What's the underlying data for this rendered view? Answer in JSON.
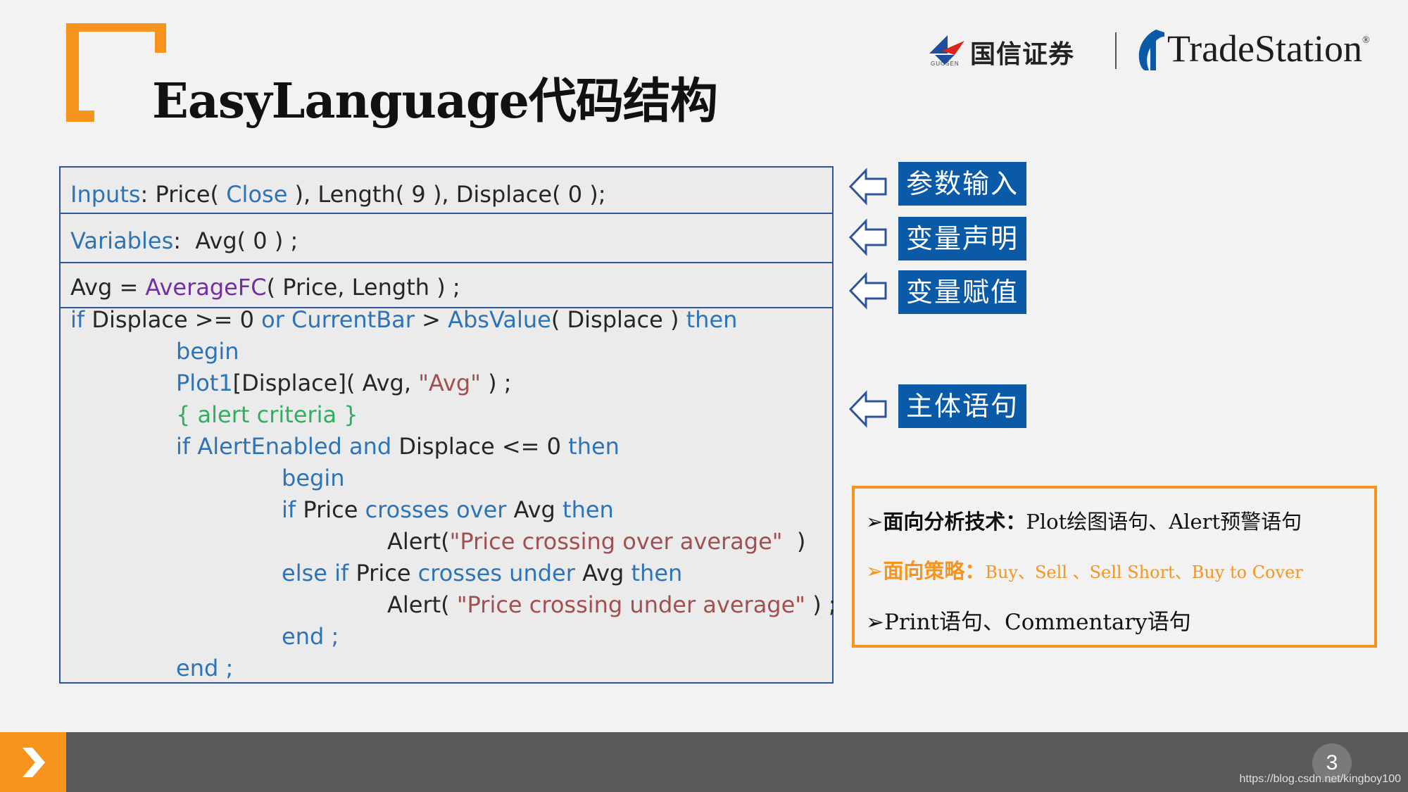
{
  "slide": {
    "title": "EasyLanguage代码结构",
    "page_number": "3",
    "watermark": "https://blog.csdn.net/kingboy100",
    "accent_color": "#f7941d",
    "code_border_color": "#2f5597",
    "label_color": "#0b5aa7"
  },
  "logos": {
    "guosen_name": "国信证券",
    "guosen_sub": "GUOSEN",
    "tradestation_name": "TradeStation",
    "tradestation_reg": "®"
  },
  "code": {
    "l1": [
      {
        "t": "Inputs",
        "c": "kw"
      },
      {
        "t": ": Price( ",
        "c": ""
      },
      {
        "t": "Close",
        "c": "kw"
      },
      {
        "t": " ), Length( 9 ), Displace( 0 );",
        "c": ""
      }
    ],
    "l2": [
      {
        "t": "Variables",
        "c": "kw"
      },
      {
        "t": ":  Avg( 0 ) ;",
        "c": ""
      }
    ],
    "l3": [
      {
        "t": "Avg = ",
        "c": ""
      },
      {
        "t": "AverageFC",
        "c": "fn"
      },
      {
        "t": "( Price, Length ) ;",
        "c": ""
      }
    ],
    "l4": [
      {
        "t": "if",
        "c": "kw"
      },
      {
        "t": " Displace >= 0 ",
        "c": ""
      },
      {
        "t": "or",
        "c": "kw"
      },
      {
        "t": " ",
        "c": ""
      },
      {
        "t": "CurrentBar",
        "c": "kw"
      },
      {
        "t": " > ",
        "c": ""
      },
      {
        "t": "AbsValue",
        "c": "kw"
      },
      {
        "t": "( Displace ) ",
        "c": ""
      },
      {
        "t": "then",
        "c": "kw"
      }
    ],
    "l5": [
      {
        "t": "begin",
        "c": "kw"
      }
    ],
    "l6": [
      {
        "t": "Plot1",
        "c": "kw"
      },
      {
        "t": "[Displace]( Avg, ",
        "c": ""
      },
      {
        "t": "\"Avg\"",
        "c": "str"
      },
      {
        "t": " ) ;",
        "c": ""
      }
    ],
    "l7": [
      {
        "t": "{ alert criteria }",
        "c": "cm"
      }
    ],
    "l8": [
      {
        "t": "if",
        "c": "kw"
      },
      {
        "t": " ",
        "c": ""
      },
      {
        "t": "AlertEnabled",
        "c": "kw"
      },
      {
        "t": " ",
        "c": ""
      },
      {
        "t": "and",
        "c": "kw"
      },
      {
        "t": " Displace <= 0 ",
        "c": ""
      },
      {
        "t": "then",
        "c": "kw"
      }
    ],
    "l9": [
      {
        "t": "begin",
        "c": "kw"
      }
    ],
    "l10": [
      {
        "t": "if",
        "c": "kw"
      },
      {
        "t": " Price ",
        "c": ""
      },
      {
        "t": "crosses over",
        "c": "kw"
      },
      {
        "t": " Avg ",
        "c": ""
      },
      {
        "t": "then",
        "c": "kw"
      }
    ],
    "l11": [
      {
        "t": "Alert(",
        "c": ""
      },
      {
        "t": "\"Price crossing over average\"",
        "c": "str"
      },
      {
        "t": "  )",
        "c": ""
      }
    ],
    "l12": [
      {
        "t": "else if",
        "c": "kw"
      },
      {
        "t": " Price ",
        "c": ""
      },
      {
        "t": "crosses under",
        "c": "kw"
      },
      {
        "t": " Avg ",
        "c": ""
      },
      {
        "t": "then",
        "c": "kw"
      }
    ],
    "l13": [
      {
        "t": "Alert( ",
        "c": ""
      },
      {
        "t": "\"Price crossing under average\"",
        "c": "str"
      },
      {
        "t": " ) ;",
        "c": ""
      }
    ],
    "l14": [
      {
        "t": "end ;",
        "c": "kw"
      }
    ],
    "l15": [
      {
        "t": "end ;",
        "c": "kw"
      }
    ]
  },
  "labels": {
    "inputs": "参数输入",
    "variables": "变量声明",
    "assignment": "变量赋值",
    "body": "主体语句"
  },
  "notes": {
    "n1_head": "面向分析技术：",
    "n1_body": "Plot绘图语句、Alert预警语句",
    "n2_head": "面向策略：",
    "n2_body": "Buy、Sell 、Sell Short、Buy to Cover",
    "n3": "Print语句、Commentary语句",
    "bullet": "➢"
  }
}
